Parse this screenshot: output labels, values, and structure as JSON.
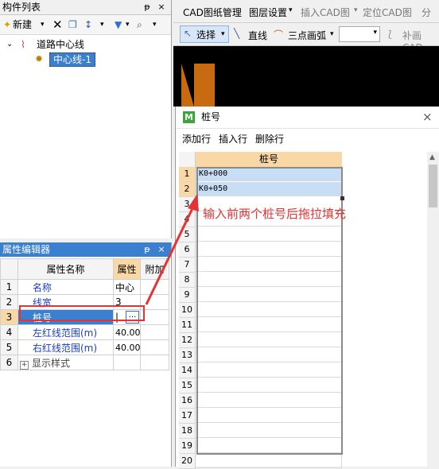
{
  "component_panel": {
    "title": "构件列表",
    "pin": "ᵽ",
    "close": "×",
    "toolbar": {
      "new_label": "新建"
    },
    "tree": {
      "root": "道路中心线",
      "child": "中心线-1"
    }
  },
  "property_panel": {
    "title": "属性编辑器",
    "pin": "ᵽ",
    "close": "×",
    "headers": {
      "name": "属性名称",
      "value": "属性",
      "extra": "附加"
    },
    "rows": [
      {
        "num": "1",
        "name": "名称",
        "value": "中心"
      },
      {
        "num": "2",
        "name": "线宽",
        "value": "3"
      },
      {
        "num": "3",
        "name": "桩号",
        "value": "|"
      },
      {
        "num": "4",
        "name": "左红线范围(m)",
        "value": "40.00"
      },
      {
        "num": "5",
        "name": "右红线范围(m)",
        "value": "40.00"
      },
      {
        "num": "6",
        "name": "显示样式",
        "value": ""
      }
    ],
    "expand_symbol": "+",
    "ellipsis": "..."
  },
  "menubar": {
    "items": [
      "CAD图纸管理",
      "图层设置",
      "插入CAD图",
      "定位CAD图",
      "分"
    ]
  },
  "toolbar2": {
    "select": "选择",
    "line": "直线",
    "arc": "三点画弧",
    "fill": "补画CAD"
  },
  "dialog": {
    "icon_letter": "M",
    "title": "桩号",
    "close": "×",
    "menu": {
      "add_row": "添加行",
      "insert_row": "插入行",
      "delete_row": "删除行"
    },
    "column_header": "桩号",
    "rows": [
      {
        "num": "1",
        "value": "K0+000"
      },
      {
        "num": "2",
        "value": "K0+050"
      },
      {
        "num": "3",
        "value": ""
      },
      {
        "num": "4",
        "value": ""
      },
      {
        "num": "5",
        "value": ""
      },
      {
        "num": "6",
        "value": ""
      },
      {
        "num": "7",
        "value": ""
      },
      {
        "num": "8",
        "value": ""
      },
      {
        "num": "9",
        "value": ""
      },
      {
        "num": "10",
        "value": ""
      },
      {
        "num": "11",
        "value": ""
      },
      {
        "num": "12",
        "value": ""
      },
      {
        "num": "13",
        "value": ""
      },
      {
        "num": "14",
        "value": ""
      },
      {
        "num": "15",
        "value": ""
      },
      {
        "num": "16",
        "value": ""
      },
      {
        "num": "17",
        "value": ""
      },
      {
        "num": "18",
        "value": ""
      },
      {
        "num": "19",
        "value": ""
      },
      {
        "num": "20",
        "value": ""
      }
    ]
  },
  "annotation": {
    "text": "输入前两个桩号后拖拉填充",
    "color": "#e53333"
  },
  "colors": {
    "accent": "#3a7fd0",
    "selection": "#c7def5",
    "highlight_border": "#e53333",
    "header_orange": "#f9d8a6"
  }
}
